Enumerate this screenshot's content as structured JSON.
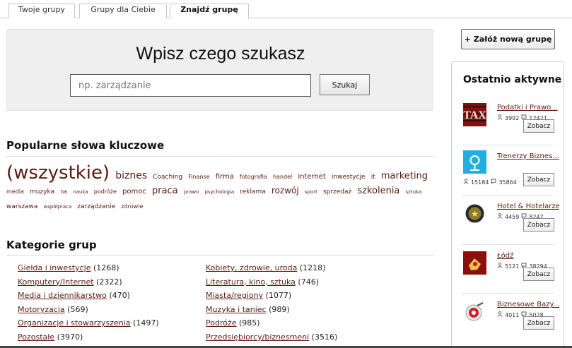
{
  "tabs": [
    {
      "label": "Twoje grupy"
    },
    {
      "label": "Grupy dla Ciebie"
    },
    {
      "label": "Znajdź grupę"
    }
  ],
  "search": {
    "title": "Wpisz czego szukasz",
    "placeholder": "np. zarządzanie",
    "button_label": "Szukaj"
  },
  "keywords": {
    "heading": "Popularne słowa kluczowe",
    "items": [
      {
        "text": "(wszystkie)",
        "size": 26
      },
      {
        "text": "biznes",
        "size": 14
      },
      {
        "text": "Coaching",
        "size": 9
      },
      {
        "text": "Finanse",
        "size": 8
      },
      {
        "text": "firma",
        "size": 10
      },
      {
        "text": "fotografia",
        "size": 8
      },
      {
        "text": "handel",
        "size": 8
      },
      {
        "text": "internet",
        "size": 10
      },
      {
        "text": "inwestycje",
        "size": 9
      },
      {
        "text": "it",
        "size": 9
      },
      {
        "text": "marketing",
        "size": 13
      },
      {
        "text": "media",
        "size": 8
      },
      {
        "text": "muzyka",
        "size": 9
      },
      {
        "text": "na",
        "size": 8
      },
      {
        "text": "nauka",
        "size": 7
      },
      {
        "text": "podróże",
        "size": 8
      },
      {
        "text": "pomoc",
        "size": 10
      },
      {
        "text": "praca",
        "size": 13
      },
      {
        "text": "prawo",
        "size": 7
      },
      {
        "text": "psychologia",
        "size": 7
      },
      {
        "text": "reklama",
        "size": 9
      },
      {
        "text": "rozwój",
        "size": 12
      },
      {
        "text": "sport",
        "size": 7
      },
      {
        "text": "sprzedaż",
        "size": 9
      },
      {
        "text": "szkolenia",
        "size": 13
      },
      {
        "text": "sztuka",
        "size": 7
      },
      {
        "text": "warszawa",
        "size": 9
      },
      {
        "text": "współpraca",
        "size": 7
      },
      {
        "text": "zarządzanie",
        "size": 9
      },
      {
        "text": "zdrowie",
        "size": 8
      }
    ]
  },
  "categories": {
    "heading": "Kategorie grup",
    "left": [
      {
        "name": "Giełda i inwestycje",
        "count": "(1268)"
      },
      {
        "name": "Komputery/Internet",
        "count": "(2322)"
      },
      {
        "name": "Media i dziennikarstwo",
        "count": "(470)"
      },
      {
        "name": "Motoryzacja",
        "count": "(569)"
      },
      {
        "name": "Organizacje i stowarzyszenia",
        "count": "(1497)"
      },
      {
        "name": "Pozostałe",
        "count": "(3970)"
      }
    ],
    "right": [
      {
        "name": "Kobiety, zdrowie, uroda",
        "count": "(1218)"
      },
      {
        "name": "Literatura, kino, sztuka",
        "count": "(746)"
      },
      {
        "name": "Miasta/regiony",
        "count": "(1077)"
      },
      {
        "name": "Muzyka i taniec",
        "count": "(989)"
      },
      {
        "name": "Podróże",
        "count": "(985)"
      },
      {
        "name": "Przedsiębiorcy/biznesmeni",
        "count": "(3516)"
      }
    ]
  },
  "sidebar": {
    "new_group_label": "+ Załóż nową grupę",
    "recent_title": "Ostatnio aktywne",
    "view_label": "Zobacz",
    "groups": [
      {
        "name": "Podatki i Prawo...",
        "members": "3992",
        "posts": "12421",
        "thumb": "tax"
      },
      {
        "name": "Trenerzy Biznes...",
        "members": "15184",
        "posts": "35864",
        "thumb": "trainer"
      },
      {
        "name": "Hotel & Hotelarze",
        "members": "4459",
        "posts": "8247",
        "thumb": "hotel"
      },
      {
        "name": "Łódź",
        "members": "5121",
        "posts": "38294",
        "thumb": "lodz"
      },
      {
        "name": "Biznesowe Bazy...",
        "members": "4011",
        "posts": "5028",
        "thumb": "target"
      }
    ]
  },
  "colors": {
    "link": "#5a1a10",
    "panel_bg": "#efefef"
  }
}
